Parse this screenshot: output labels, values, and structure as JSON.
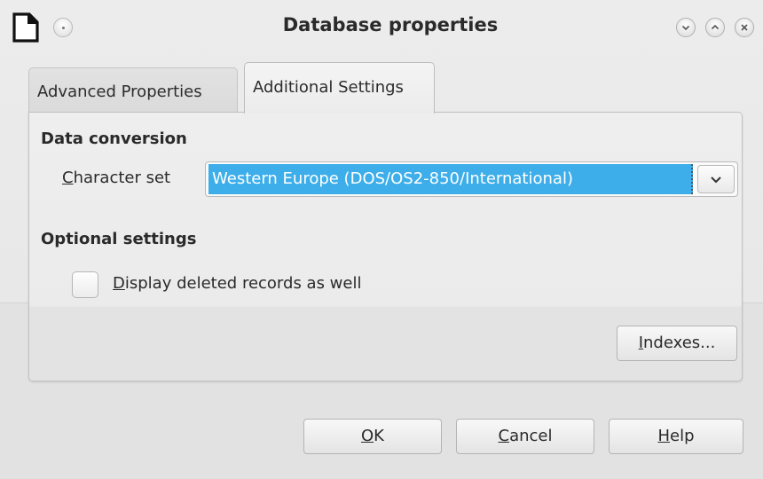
{
  "window": {
    "title": "Database properties",
    "icons": {
      "app": "libreoffice-document-icon",
      "menu": "window-menu-icon",
      "minimize": "chevron-down-icon",
      "maximize": "chevron-up-icon",
      "close": "close-icon"
    }
  },
  "tabs": [
    {
      "label": "Advanced Properties",
      "selected": false
    },
    {
      "label": "Additional Settings",
      "selected": true
    }
  ],
  "data_conversion": {
    "heading": "Data conversion",
    "character_set": {
      "label_mnemonic": "C",
      "label_rest": "haracter set",
      "value": "Western Europe (DOS/OS2-850/International)"
    }
  },
  "optional_settings": {
    "heading": "Optional settings",
    "display_deleted": {
      "label_mnemonic": "D",
      "label_rest": "isplay deleted records as well",
      "checked": false
    }
  },
  "buttons": {
    "indexes": {
      "mnemonic": "I",
      "rest": "ndexes..."
    },
    "ok": {
      "mnemonic": "O",
      "rest": "K"
    },
    "cancel": {
      "mnemonic": "C",
      "rest": "ancel"
    },
    "help": {
      "mnemonic": "H",
      "rest": "elp"
    }
  },
  "colors": {
    "selection": "#3daee9",
    "background": "#e6e6e6"
  }
}
